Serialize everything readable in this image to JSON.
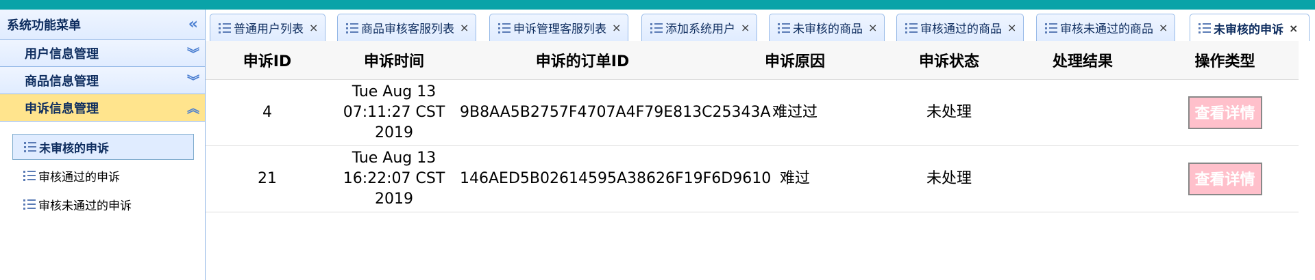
{
  "sidebar": {
    "title": "系统功能菜单",
    "collapse_icon": "«",
    "sections": [
      {
        "label": "用户信息管理",
        "tool_icon": "chevron-double-down-icon",
        "tool_glyph": "︾"
      },
      {
        "label": "商品信息管理",
        "tool_icon": "chevron-double-down-icon",
        "tool_glyph": "︾"
      },
      {
        "label": "申诉信息管理",
        "tool_icon": "chevron-double-up-icon",
        "tool_glyph": "︽"
      }
    ],
    "items": [
      {
        "label": "未审核的申诉"
      },
      {
        "label": "审核通过的申诉"
      },
      {
        "label": "审核未通过的申诉"
      }
    ]
  },
  "tabs": [
    {
      "label": "普通用户列表"
    },
    {
      "label": "商品审核客服列表"
    },
    {
      "label": "申诉管理客服列表"
    },
    {
      "label": "添加系统用户"
    },
    {
      "label": "未审核的商品"
    },
    {
      "label": "审核通过的商品"
    },
    {
      "label": "审核未通过的商品"
    },
    {
      "label": "未审核的申诉"
    }
  ],
  "tab_close_glyph": "×",
  "table": {
    "headers": [
      "申诉ID",
      "申诉时间",
      "申诉的订单ID",
      "申诉原因",
      "申诉状态",
      "处理结果",
      "操作类型"
    ],
    "rows": [
      {
        "id": "4",
        "time1": "Tue Aug 13",
        "time2": "07:11:27 CST",
        "time3": "2019",
        "order": "9B8AA5B2757F4707A4F79E813C25343A",
        "reason": "难过过",
        "status": "未处理",
        "result": "",
        "action": "查看详情"
      },
      {
        "id": "21",
        "time1": "Tue Aug 13",
        "time2": "16:22:07 CST",
        "time3": "2019",
        "order": "146AED5B02614595A38626F19F6D9610",
        "reason": "难过",
        "status": "未处理",
        "result": "",
        "action": "查看详情"
      }
    ]
  },
  "colors": {
    "topbar": "#0aa3a8",
    "active_section": "#ffe48d",
    "detail_button_bg": "#ffc0cb"
  }
}
